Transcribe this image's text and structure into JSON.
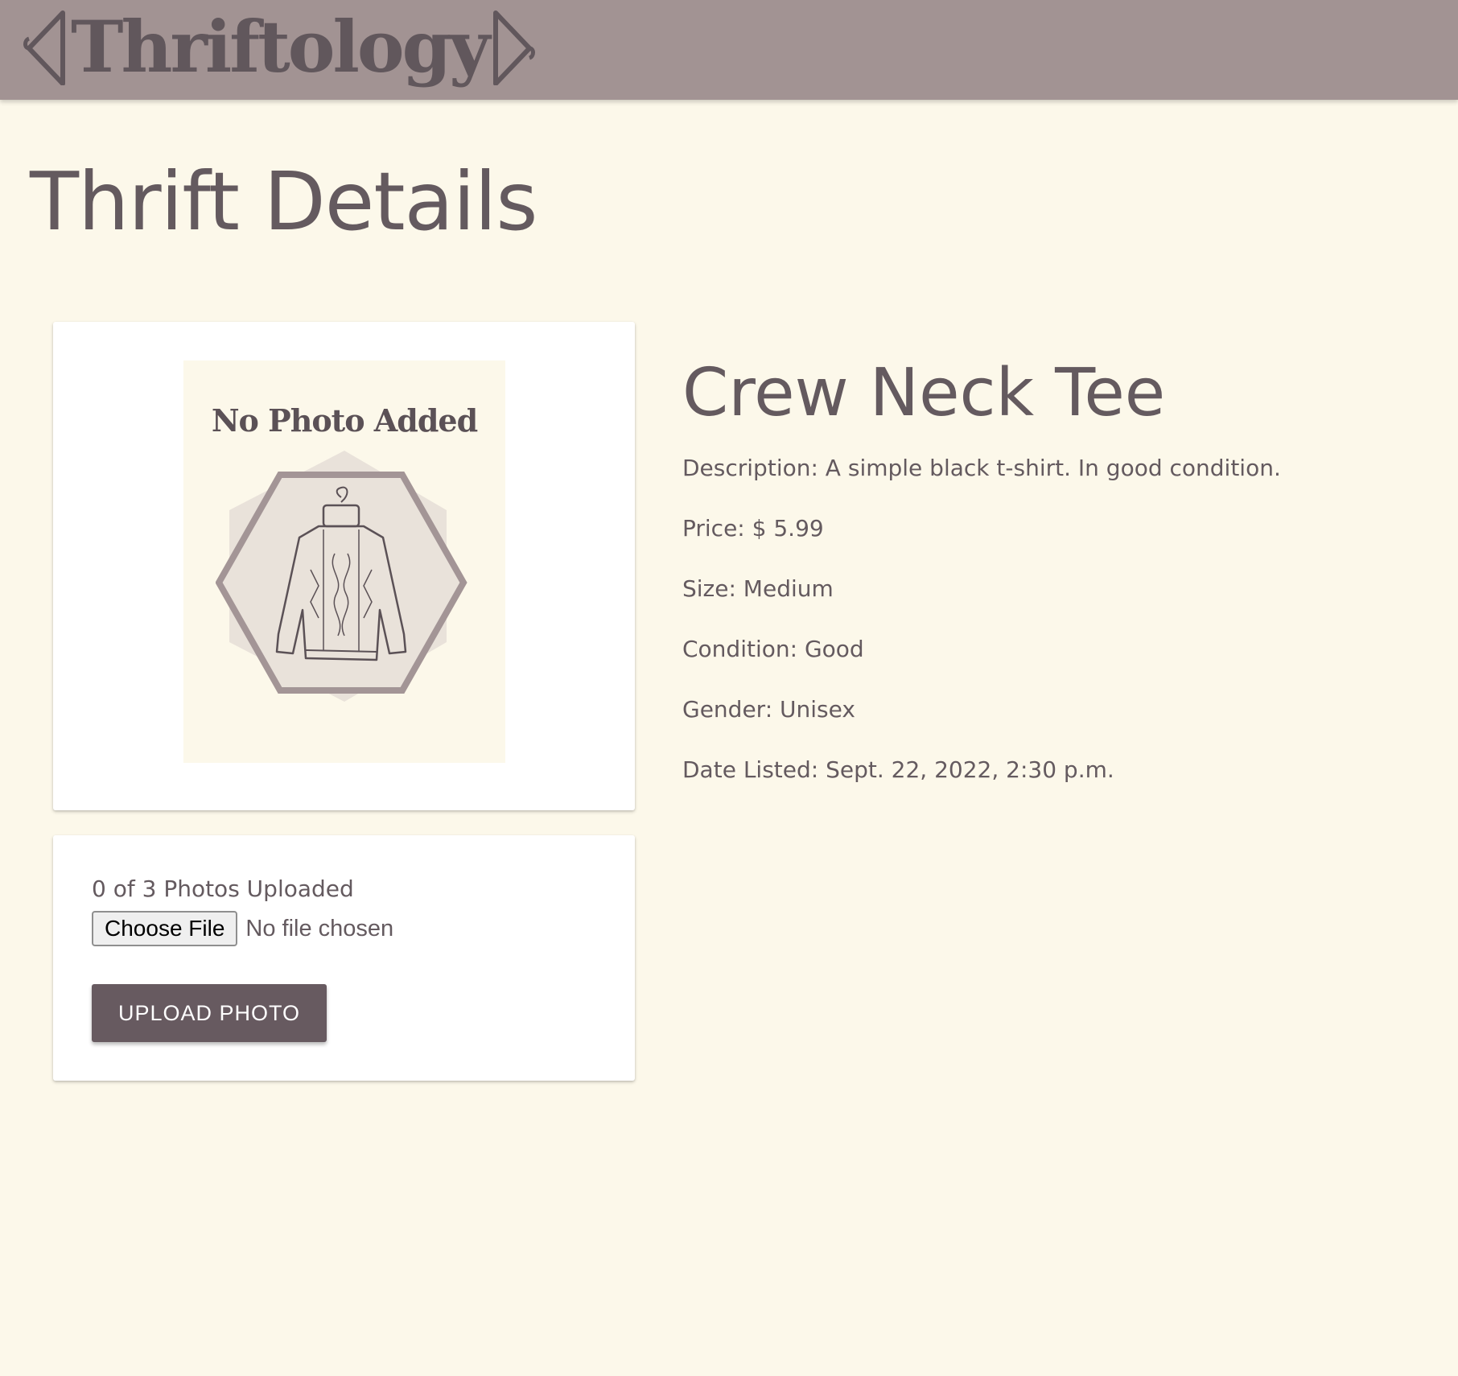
{
  "navbar": {
    "logo_text": "Thriftology",
    "logo_left_icon": "hanger-left-icon",
    "logo_right_icon": "hanger-right-icon"
  },
  "page": {
    "title": "Thrift Details"
  },
  "photo_card": {
    "placeholder_title": "No Photo Added",
    "placeholder_icon": "sweater-icon"
  },
  "upload": {
    "count_text": "0 of 3 Photos Uploaded",
    "choose_file_label": "Choose File",
    "file_status": "No file chosen",
    "upload_button_label": "UPLOAD PHOTO"
  },
  "item": {
    "name": "Crew Neck Tee",
    "description": "Description: A simple black t-shirt. In good condition.",
    "price": "Price: $ 5.99",
    "size": "Size: Medium",
    "condition": "Condition: Good",
    "gender": "Gender: Unisex",
    "date_listed": "Date Listed: Sept. 22, 2022, 2:30 p.m."
  },
  "colors": {
    "background": "#fcf8ea",
    "navbar": "#a29393",
    "text": "#645a5f",
    "button": "#675a60"
  }
}
